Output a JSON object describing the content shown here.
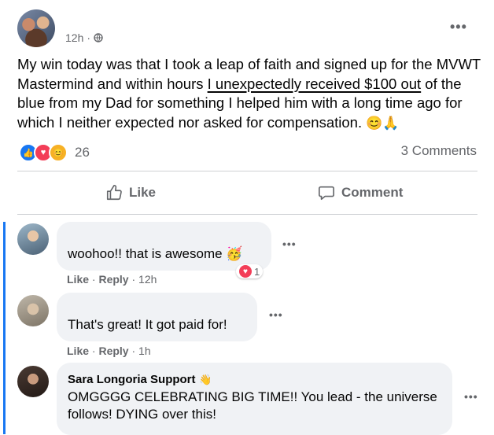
{
  "post": {
    "time": "12h",
    "text_before": "My win today was that I took a leap of faith and signed up for the MVWT Mastermind and within hours ",
    "text_highlight": "I unexpectedly received $100 out",
    "text_after": " of the blue from my Dad for something I helped him with a long time ago for which I neither expected nor asked for compensation.",
    "emojis": "😊🙏",
    "reaction_count": "26",
    "comments_count": "3 Comments",
    "more": "•••"
  },
  "actions": {
    "like": "Like",
    "comment": "Comment"
  },
  "comments": [
    {
      "text": "woohoo!! that is awesome",
      "emoji": "🥳",
      "like": "Like",
      "reply": "Reply",
      "time": "12h",
      "reaction_count": "1"
    },
    {
      "text": "That's great! It got paid for!",
      "like": "Like",
      "reply": "Reply",
      "time": "1h"
    },
    {
      "author": "Sara Longoria Support",
      "author_emoji": "👋",
      "text": "OMGGGG CELEBRATING BIG TIME!! You lead - the universe follows! DYING over this!"
    }
  ],
  "colors": {
    "accent": "#1877f2",
    "love": "#f33e58",
    "muted": "#65676b"
  }
}
